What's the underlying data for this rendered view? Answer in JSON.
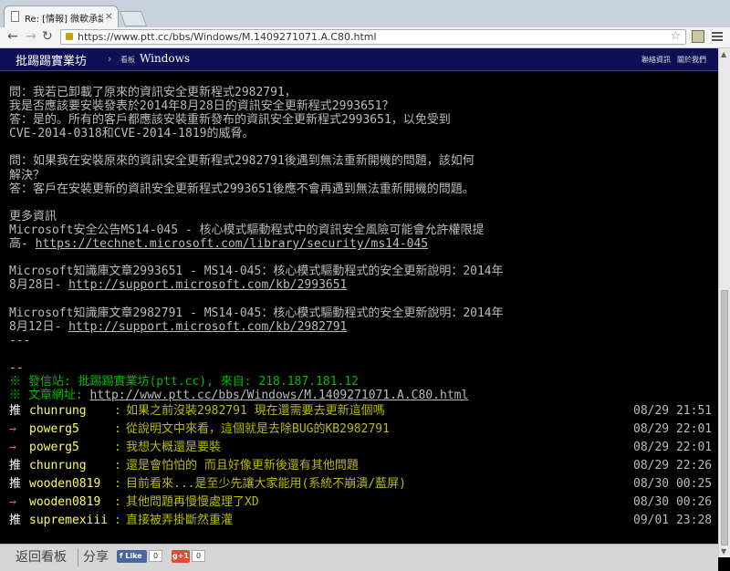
{
  "browser": {
    "tab_title": "Re: [情報] 微軟承認8.1的",
    "tab_close": "×",
    "url": "https://www.ptt.cc/bbs/Windows/M.1409271071.A.C80.html"
  },
  "header": {
    "site_name": "批踢踢實業坊",
    "crumb_sep": "›",
    "board_label": "看板",
    "board": "Windows",
    "links": [
      "聯絡資訊",
      "關於我們"
    ]
  },
  "article": {
    "lines": [
      "問：我若已卸載了原來的資訊安全更新程式2982791，",
      "我是否應該要安裝發表於2014年8月28日的資訊安全更新程式2993651？",
      "答：是的。所有的客戶都應該安裝重新發布的資訊安全更新程式2993651，以免受到",
      "CVE-2014-0318和CVE-2014-1819的威脅。",
      "",
      "問：如果我在安裝原來的資訊安全更新程式2982791後遇到無法重新開機的問題，該如何",
      "解決？",
      "答：客戶在安裝更新的資訊安全更新程式2993651後應不會再遇到無法重新開機的問題。",
      "",
      "更多資訊",
      "Microsoft安全公告MS14-045 - 核心模式驅動程式中的資訊安全風險可能會允許權限提"
    ],
    "ref1_prefix": "高- ",
    "ref1_link": "https://technet.microsoft.com/library/security/ms14-045",
    "ref2_line": "Microsoft知識庫文章2993651 - MS14-045：核心模式驅動程式的安全更新說明：2014年",
    "ref2_prefix": "8月28日- ",
    "ref2_link": "http://support.microsoft.com/kb/2993651",
    "ref3_line": "Microsoft知識庫文章2982791 - MS14-045：核心模式驅動程式的安全更新說明：2014年",
    "ref3_prefix": "8月12日- ",
    "ref3_link": "http://support.microsoft.com/kb/2982791",
    "end_mark": "---",
    "sig_mark": "--",
    "sent_from": "※ 發信站: 批踢踢實業坊(ptt.cc), 來自: 218.187.181.12",
    "url_prefix": "※ 文章網址: ",
    "url_link": "http://www.ptt.cc/bbs/Windows/M.1409271071.A.C80.html"
  },
  "pushes": [
    {
      "tag": "推",
      "user": "chunrung",
      "msg": "如果之前沒裝2982791 現在還需要去更新這個嗎",
      "time": "08/29 21:51"
    },
    {
      "tag": "→",
      "user": "powerg5",
      "msg": "從說明文中來看，這個就是去除BUG的KB2982791",
      "time": "08/29 22:01"
    },
    {
      "tag": "→",
      "user": "powerg5",
      "msg": "我想大概還是要裝",
      "time": "08/29 22:01"
    },
    {
      "tag": "推",
      "user": "chunrung",
      "msg": "還是會怕怕的 而且好像更新後還有其他問題",
      "time": "08/29 22:26"
    },
    {
      "tag": "推",
      "user": "wooden0819",
      "msg": "目前看來...是至少先讓大家能用(系統不崩潰/藍屏)",
      "time": "08/30 00:25"
    },
    {
      "tag": "→",
      "user": "wooden0819",
      "msg": "其他問題再慢慢處理了XD",
      "time": "08/30 00:26"
    },
    {
      "tag": "推",
      "user": "supremexiii",
      "msg": "直接被弄掛斷然重灌",
      "time": "09/01 23:28"
    }
  ],
  "push_colon": ":",
  "bottom": {
    "back": "返回看板",
    "share": "分享",
    "fb_like": "Like",
    "fb_count": "0",
    "gplus": "g+1",
    "gplus_count": "0"
  }
}
